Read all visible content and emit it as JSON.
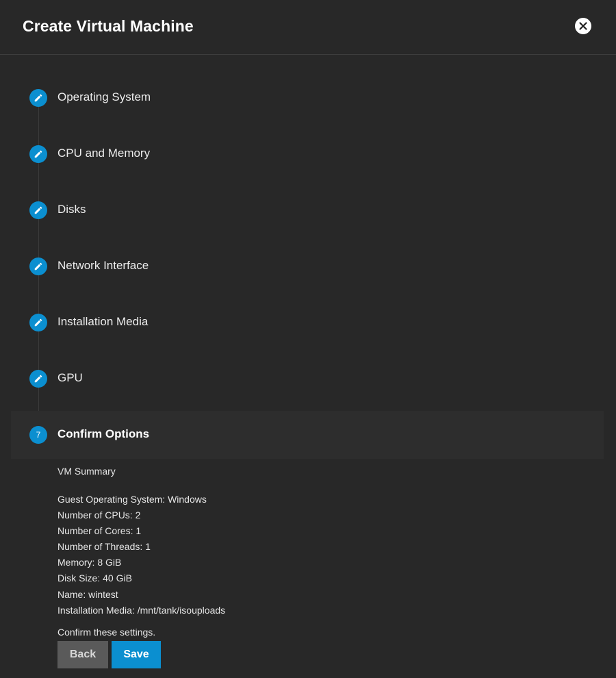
{
  "dialog": {
    "title": "Create Virtual Machine"
  },
  "steps": [
    {
      "label": "Operating System",
      "icon": "pencil-icon",
      "state": "completed"
    },
    {
      "label": "CPU and Memory",
      "icon": "pencil-icon",
      "state": "completed"
    },
    {
      "label": "Disks",
      "icon": "pencil-icon",
      "state": "completed"
    },
    {
      "label": "Network Interface",
      "icon": "pencil-icon",
      "state": "completed"
    },
    {
      "label": "Installation Media",
      "icon": "pencil-icon",
      "state": "completed"
    },
    {
      "label": "GPU",
      "icon": "pencil-icon",
      "state": "completed"
    },
    {
      "label": "Confirm Options",
      "number": "7",
      "state": "active"
    }
  ],
  "summary": {
    "heading": "VM Summary",
    "lines": [
      "Guest Operating System: Windows",
      "Number of CPUs: 2",
      "Number of Cores: 1",
      "Number of Threads: 1",
      "Memory: 8 GiB",
      "Disk Size: 40 GiB",
      "Name: wintest",
      "Installation Media: /mnt/tank/isouploads"
    ],
    "confirm_text": "Confirm these settings."
  },
  "buttons": {
    "back": "Back",
    "save": "Save"
  },
  "colors": {
    "background": "#282828",
    "accent": "#0b8fd0",
    "back_button": "#5a5a5a"
  }
}
